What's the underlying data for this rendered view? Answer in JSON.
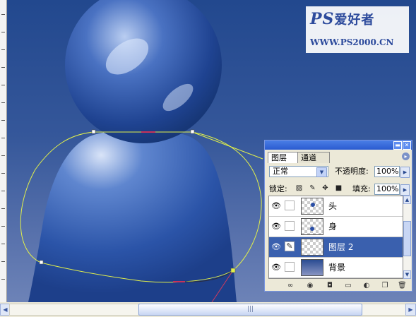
{
  "watermark": {
    "line1": "PS",
    "line1_suffix": "爱好者",
    "line2": "WWW.PS2000.CN"
  },
  "layers_panel": {
    "title_buttons": [
      "minimize-icon",
      "close-icon"
    ],
    "tabs": [
      {
        "label": "图层",
        "active": true
      },
      {
        "label": "通道",
        "active": false
      }
    ],
    "blend_mode": "正常",
    "opacity_label": "不透明度:",
    "opacity_value": "100%",
    "lock_label": "锁定:",
    "fill_label": "填充:",
    "fill_value": "100%",
    "lock_icons": [
      "lock-transparent-icon",
      "lock-paint-icon",
      "lock-move-icon",
      "lock-all-icon"
    ],
    "layers": [
      {
        "name": "头",
        "visible": true,
        "selected": false,
        "thumb": "head-thumb"
      },
      {
        "name": "身",
        "visible": true,
        "selected": false,
        "thumb": "body-thumb"
      },
      {
        "name": "图层 2",
        "visible": true,
        "selected": true,
        "thumb": "empty-thumb"
      },
      {
        "name": "背景",
        "visible": true,
        "selected": false,
        "thumb": "gradient-thumb"
      }
    ],
    "bottom_icons": [
      "link-layers-icon",
      "layer-style-icon",
      "layer-mask-icon",
      "new-group-icon",
      "adjustment-layer-icon",
      "new-layer-icon",
      "delete-layer-icon"
    ]
  },
  "colors": {
    "canvas_top": "#22488e",
    "canvas_bottom": "#6d83b7",
    "figure": "#2d57aa",
    "path": "#e2f04a",
    "selection": "#3a60ae"
  }
}
